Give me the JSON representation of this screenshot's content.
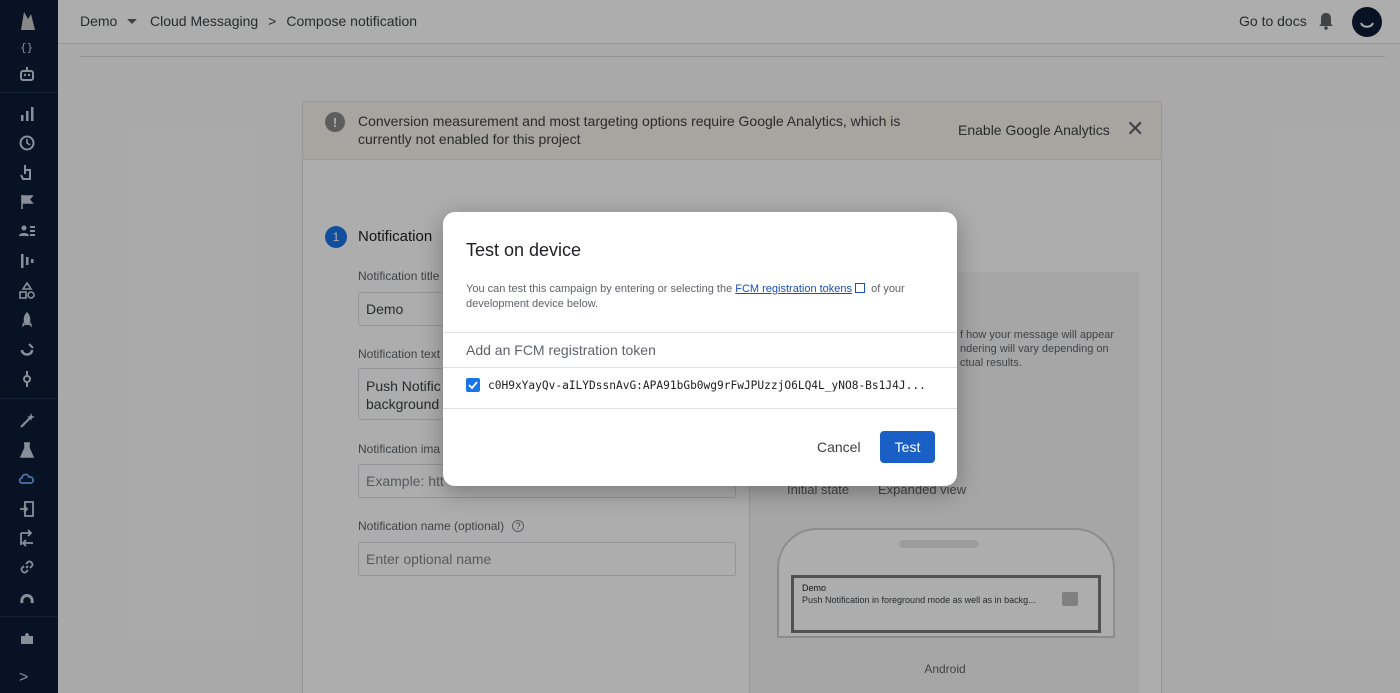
{
  "topbar": {
    "project": "Demo",
    "breadcrumb": {
      "section": "Cloud Messaging",
      "separator": ">",
      "page": "Compose notification"
    },
    "docs_link": "Go to docs"
  },
  "sidebar": {
    "icons": [
      "braces-icon",
      "robot-icon",
      "bar-chart-icon",
      "clock-icon",
      "touch-icon",
      "flag-icon",
      "users-icon",
      "funnel-icon",
      "shapes-icon",
      "rocket-icon",
      "magnet-icon",
      "tune-icon",
      "wand-icon",
      "flask-icon",
      "cloud-sync-icon",
      "in-app-icon",
      "ab-test-icon",
      "link-icon",
      "admob-icon",
      "puzzle-icon"
    ],
    "expand_label": ">"
  },
  "banner": {
    "message": "Conversion measurement and most targeting options require Google Analytics, which is currently not enabled for this project",
    "action": "Enable Google Analytics",
    "close": "✕",
    "icon_glyph": "!"
  },
  "form": {
    "step_number": "1",
    "step_title": "Notification",
    "title_label": "Notification title",
    "title_value": "Demo",
    "text_label": "Notification text",
    "text_value_line1": "Push Notific",
    "text_value_line2": "background",
    "image_label": "Notification ima",
    "image_placeholder": "Example: htt",
    "name_label": "Notification name (optional)",
    "name_placeholder": "Enter optional name",
    "help_glyph": "?"
  },
  "preview": {
    "desc_line1": "f how your message will appear",
    "desc_line2": "ndering will vary depending on",
    "desc_line3": "ctual results.",
    "tab_initial": "Initial state",
    "tab_expanded": "Expanded view",
    "notif_title": "Demo",
    "notif_body": "Push Notification in foreground mode as well as in backg...",
    "device": "Android"
  },
  "dialog": {
    "title": "Test on device",
    "intro_before": "You can test this campaign by entering or selecting the ",
    "intro_link": "FCM registration tokens",
    "intro_after": " of your development device below.",
    "token_placeholder": "Add an FCM registration token",
    "token_value": "c0H9xYayQv-aILYDssnAvG:APA91bGb0wg9rFwJPUzzjO6LQ4L_yNO8-Bs1J4J...",
    "token_checked": true,
    "cancel_label": "Cancel",
    "test_label": "Test"
  },
  "colors": {
    "sidebar_bg": "#0b1c35",
    "primary": "#1a5fc6",
    "banner_bg": "#f7f3ec"
  }
}
